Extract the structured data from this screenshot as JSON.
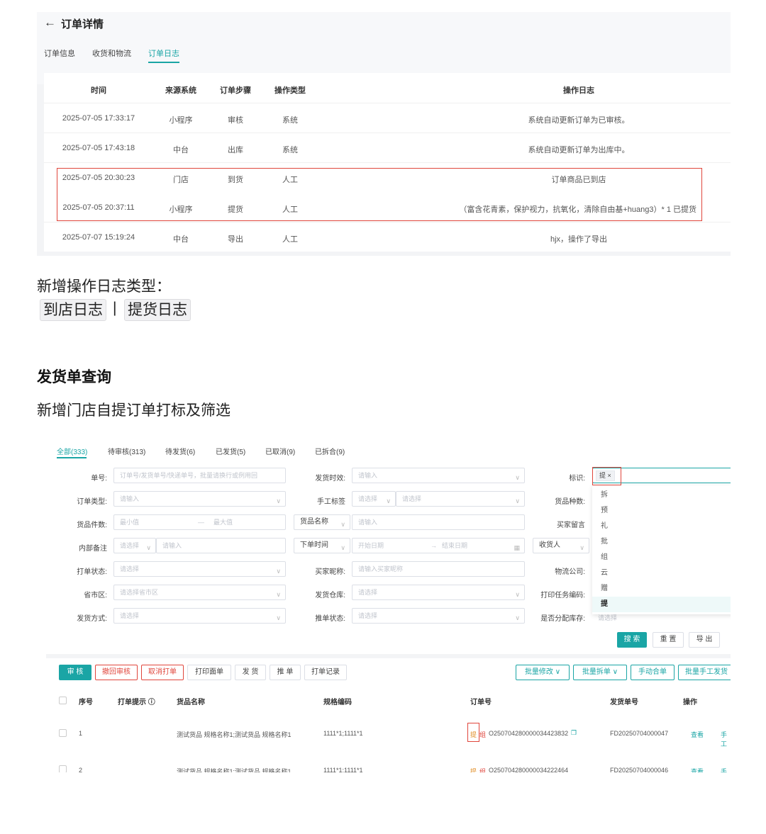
{
  "shot1": {
    "back": "←",
    "title": "订单详情",
    "tabs": [
      "订单信息",
      "收货和物流",
      "订单日志"
    ],
    "headers": [
      "时间",
      "来源系统",
      "订单步骤",
      "操作类型",
      "操作日志"
    ],
    "rows": [
      [
        "2025-07-05 17:33:17",
        "小程序",
        "审核",
        "系统",
        "系统自动更新订单为已审核。"
      ],
      [
        "2025-07-05 17:43:18",
        "中台",
        "出库",
        "系统",
        "系统自动更新订单为出库中。"
      ],
      [
        "2025-07-05 20:30:23",
        "门店",
        "到货",
        "人工",
        "订单商品已到店"
      ],
      [
        "2025-07-05 20:37:11",
        "小程序",
        "提货",
        "人工",
        "（富含花青素，保护视力，抗氧化，清除自由基+huang3）* 1 已提货"
      ],
      [
        "2025-07-07 15:19:24",
        "中台",
        "导出",
        "人工",
        "hjx，操作了导出"
      ]
    ]
  },
  "notes": {
    "new_log_types": "新增操作日志类型：",
    "chip1": "到店日志",
    "sep": "|",
    "chip2": "提货日志",
    "section_title": "发货单查询",
    "subtitle": "新增门店自提订单打标及筛选"
  },
  "shot2": {
    "tabs": [
      "全部(333)",
      "待审核(313)",
      "待发货(6)",
      "已发货(5)",
      "已取消(9)",
      "已拆合(9)"
    ],
    "filters": {
      "order_no_label": "单号:",
      "order_no_placeholder": "订单号/发货单号/快递单号，批量请换行或例用回",
      "ship_time_label": "发货时效:",
      "ship_time_placeholder": "请输入",
      "tag_label": "标识:",
      "order_type_label": "订单类型:",
      "order_type_placeholder": "请输入",
      "manual_tag_label": "手工标签",
      "manual_tag_ph1": "请选择",
      "manual_tag_ph2": "请选择",
      "goods_kind_label": "货品种数:",
      "goods_qty_label": "货品件数:",
      "min_placeholder": "最小值",
      "dash": "—",
      "max_placeholder": "最大值",
      "goods_name_select": "货品名称",
      "goods_name_placeholder": "请输入",
      "buyer_msg_label": "买家留言",
      "internal_note_label": "内部备注",
      "internal_ph1": "请选择",
      "internal_ph2": "请输入",
      "order_time_select": "下单时间",
      "start_date": "开始日期",
      "arrow": "→",
      "end_date": "结束日期",
      "receiver_select": "收货人",
      "print_status_label": "打单状态:",
      "print_status_placeholder": "请选择",
      "buyer_nick_label": "买家昵称:",
      "buyer_nick_placeholder": "请输入买家昵称",
      "logistics_label": "物流公司:",
      "region_label": "省市区:",
      "region_placeholder": "请选择省市区",
      "warehouse_label": "发货仓库:",
      "warehouse_placeholder": "请选择",
      "print_task_label": "打印任务编码:",
      "ship_method_label": "发货方式:",
      "ship_method_placeholder": "请选择",
      "push_status_label": "推单状态:",
      "push_status_placeholder": "请选择",
      "allocate_label": "是否分配库存:",
      "allocate_placeholder": "请选择"
    },
    "tag_select": {
      "chosen": "提",
      "close": "×",
      "options": [
        "拆",
        "预",
        "礼",
        "批",
        "组",
        "云",
        "赠",
        "提"
      ]
    },
    "buttons": {
      "search": "搜 索",
      "reset": "重 置",
      "export": "导 出"
    },
    "toolbar": [
      "审 核",
      "撤回审核",
      "取消打单",
      "打印面单",
      "发 货",
      "推 单",
      "打单记录"
    ],
    "toolbar_right": [
      "批量修改",
      "批量拆单",
      "手动合单",
      "批量手工发货"
    ],
    "columns": [
      "序号",
      "打单提示",
      "货品名称",
      "规格编码",
      "订单号",
      "发货单号",
      "操作"
    ],
    "rows": [
      {
        "no": "1",
        "goods": "测试货品 规格名称1;测试货品 规格名称1",
        "spec": "1111*1;1111*1",
        "tag1": "提",
        "tag2": "组",
        "order": "O250704280000034423832",
        "ship": "FD20250704000047",
        "view": "查看",
        "manual": "手工"
      },
      {
        "no": "2",
        "goods": "测试货品 规格名称1;测试货品 规格名称1",
        "spec": "1111*1;1111*1",
        "tag1": "提",
        "tag2": "组",
        "order": "O250704280000034222464",
        "ship": "FD20250704000046",
        "view": "查看",
        "manual": "手工"
      }
    ]
  }
}
